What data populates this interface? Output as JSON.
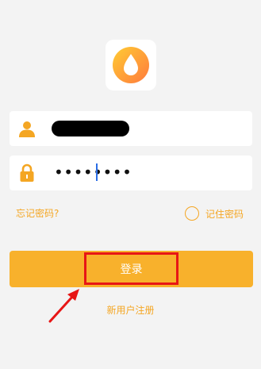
{
  "app": {
    "logo_icon": "drop-icon",
    "brand_colors": {
      "accent": "#f4a623",
      "button": "#f8b12c",
      "logo_gradient_start": "#ffcc33",
      "logo_gradient_end": "#ff7a3d"
    }
  },
  "username_field": {
    "icon": "user-icon",
    "value_masked": true
  },
  "password_field": {
    "icon": "lock-icon",
    "value": "••••••••"
  },
  "links": {
    "forgot_password": "忘记密码?",
    "remember_password": "记住密码",
    "register": "新用户注册"
  },
  "remember_password_checked": false,
  "login_button": {
    "label": "登录"
  },
  "annotations": {
    "highlight_color": "#e71616",
    "arrow_icon": "red-arrow-icon"
  }
}
